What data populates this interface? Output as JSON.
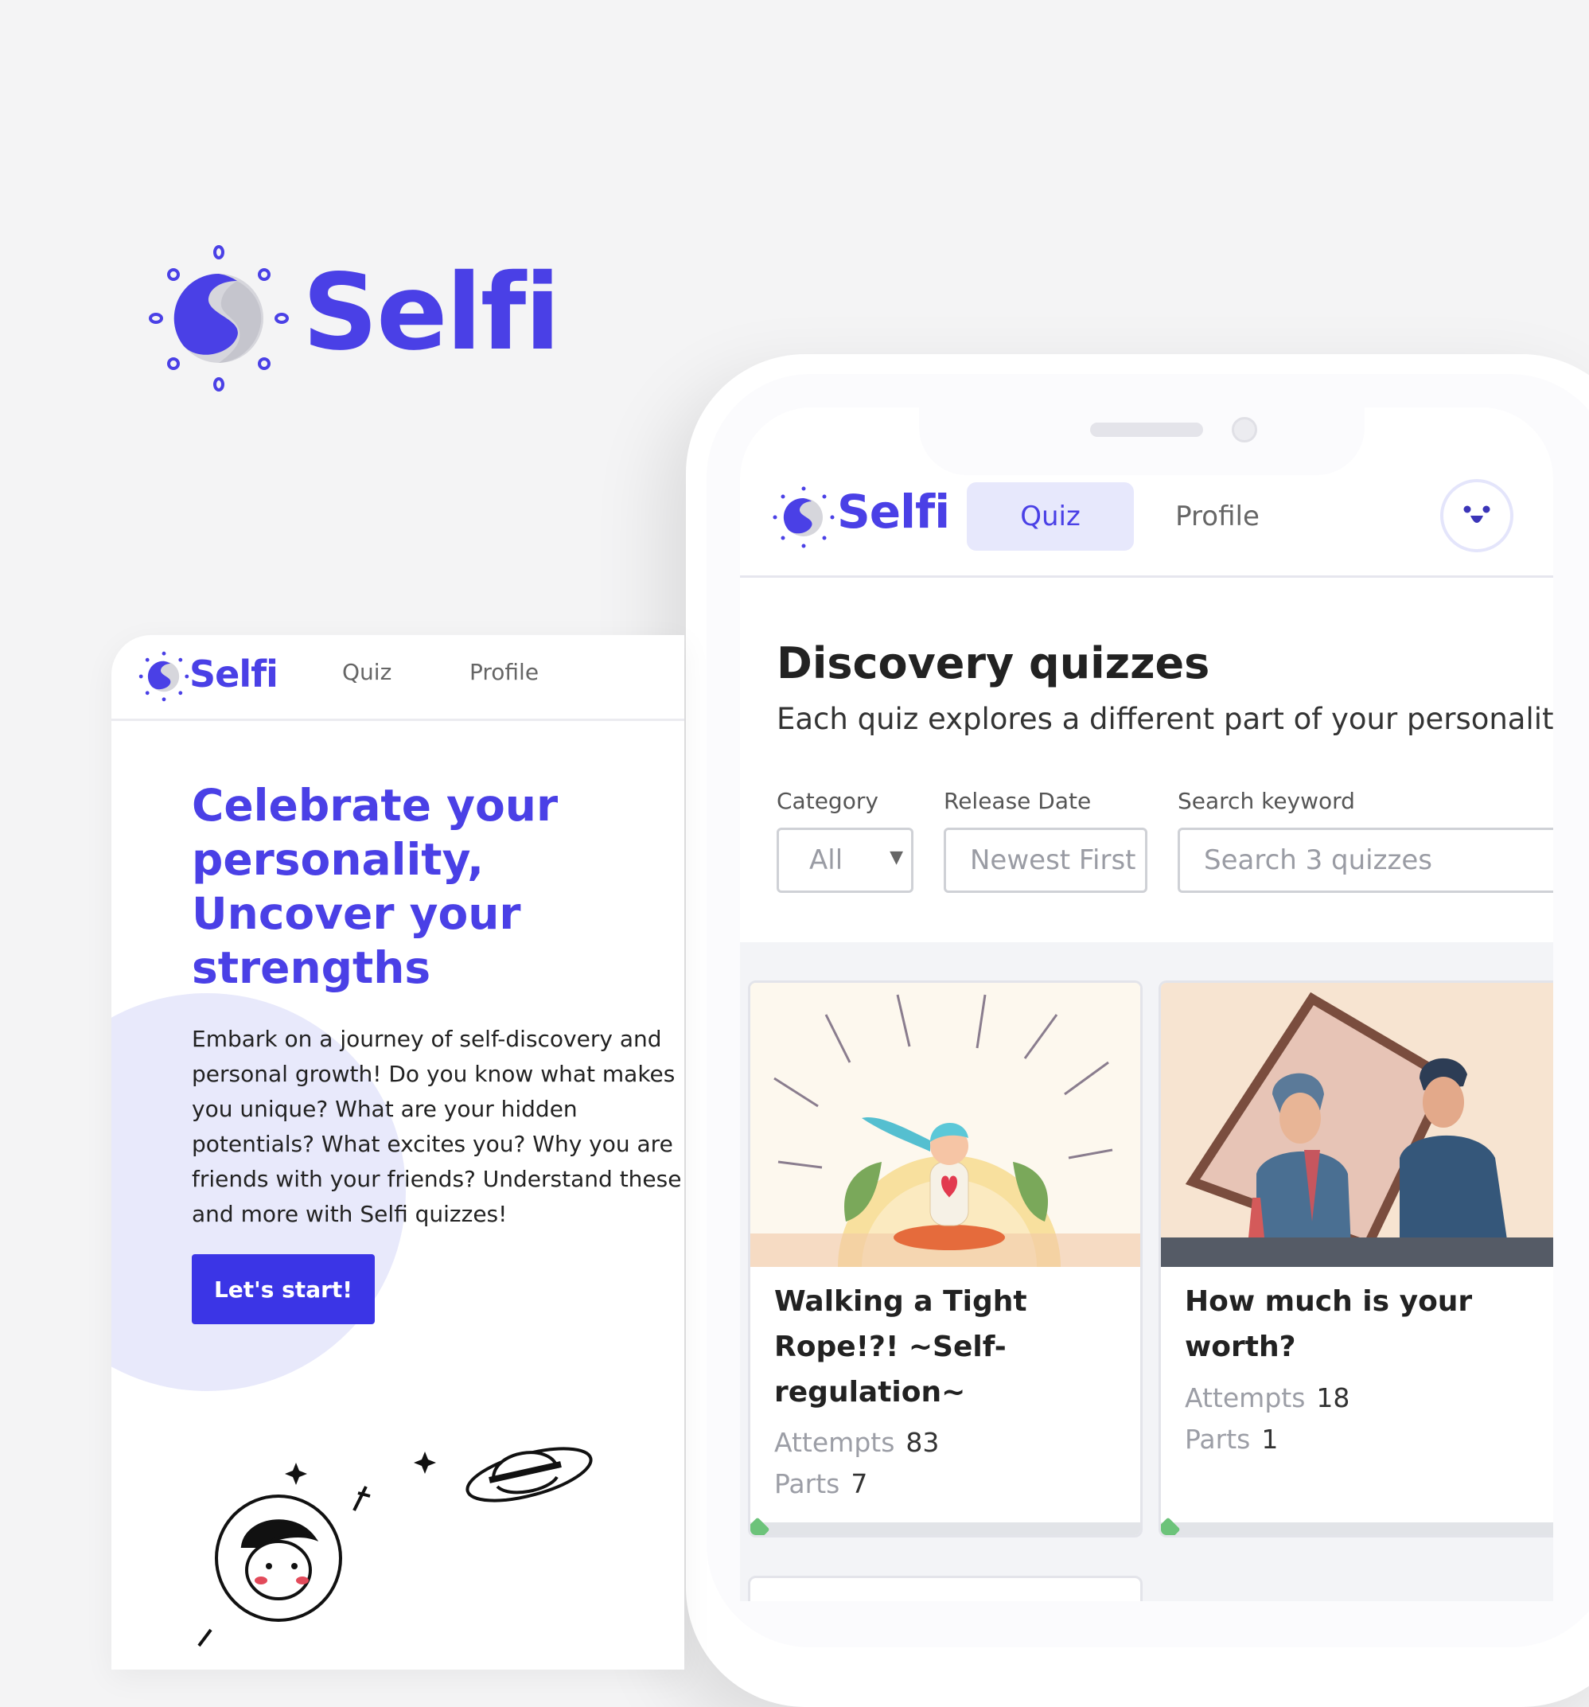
{
  "brand": {
    "name": "Selfi",
    "color": "#4a40e6",
    "logo_icon": "selfi-sun-logo-icon"
  },
  "phone": {
    "nav": {
      "logo_text": "Selfi",
      "tabs": [
        {
          "label": "Quiz",
          "active": true
        },
        {
          "label": "Profile",
          "active": false
        }
      ],
      "avatar_icon": "smiley-face-icon"
    },
    "heading": "Discovery quizzes",
    "subheading": "Each quiz explores a different part of your personality",
    "filters": {
      "category": {
        "label": "Category",
        "value": "All"
      },
      "release_date": {
        "label": "Release Date",
        "value": "Newest First"
      },
      "search": {
        "label": "Search keyword",
        "placeholder": "Search 3 quizzes"
      }
    },
    "quizzes": [
      {
        "title": "Walking a Tight Rope!?! ~Self-regulation~",
        "attempts_label": "Attempts",
        "attempts": "83",
        "parts_label": "Parts",
        "parts": "7",
        "image_icon": "meditation-illustration"
      },
      {
        "title": "How much is your worth?",
        "attempts_label": "Attempts",
        "attempts": "18",
        "parts_label": "Parts",
        "parts": "1",
        "image_icon": "mirror-portrait-illustration"
      }
    ]
  },
  "desktop": {
    "nav": {
      "logo_text": "Selfi",
      "links": [
        "Quiz",
        "Profile"
      ]
    },
    "hero_title": "Celebrate your personality, Uncover your strengths",
    "hero_text": "Embark on a journey of self-discovery and personal growth! Do you know what makes you unique? What are your hidden potentials? What excites you? Why you are friends with your friends? Understand these and more with Selfi quizzes!",
    "cta_label": "Let's start!",
    "illustration_icon": "astronaut-planet-doodle"
  }
}
